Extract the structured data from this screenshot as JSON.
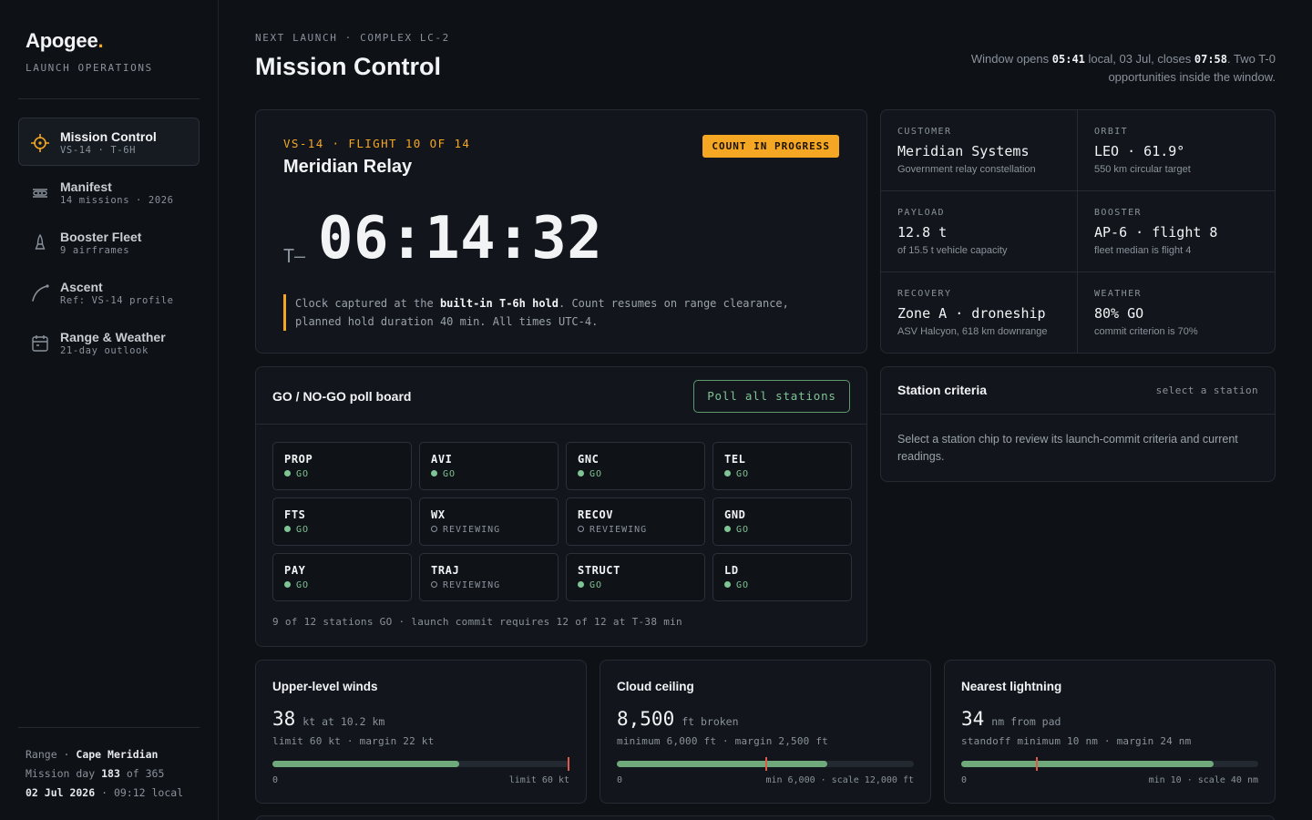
{
  "sidebar": {
    "brand": "Apogee",
    "brand_dot": ".",
    "subtitle": "LAUNCH OPERATIONS",
    "items": [
      {
        "label": "Mission Control",
        "sub": "VS-14 · T-6H",
        "icon": "target-icon"
      },
      {
        "label": "Manifest",
        "sub": "14 missions · 2026",
        "icon": "manifest-icon"
      },
      {
        "label": "Booster Fleet",
        "sub": "9 airframes",
        "icon": "rocket-icon"
      },
      {
        "label": "Ascent",
        "sub": "Ref: VS-14 profile",
        "icon": "trajectory-icon"
      },
      {
        "label": "Range & Weather",
        "sub": "21-day outlook",
        "icon": "calendar-icon"
      }
    ],
    "footer": {
      "range_label": "Range",
      "range_value": "Cape Meridian",
      "mission_day_label": "Mission day",
      "mission_day_value": "183",
      "mission_day_of": "of 365",
      "date": "02 Jul 2026",
      "time": "· 09:12 local"
    }
  },
  "header": {
    "eyebrow": "NEXT LAUNCH · COMPLEX LC-2",
    "title": "Mission Control",
    "window": {
      "prefix": "Window opens",
      "open_time": "05:41",
      "mid": "local, 03 Jul, closes",
      "close_time": "07:58",
      "suffix": ". Two T-0 opportunities inside the window."
    }
  },
  "hero": {
    "flight_tag": "VS-14 · FLIGHT 10 OF 14",
    "mission_name": "Meridian Relay",
    "status": "COUNT IN PROGRESS",
    "t_prefix": "T–",
    "countdown": "06:14:32",
    "note_a": "Clock captured at the",
    "note_bold": "built-in T-6h hold",
    "note_b": ". Count resumes on range clearance, planned hold duration 40 min. All times UTC-4."
  },
  "facts": [
    {
      "label": "CUSTOMER",
      "value": "Meridian Systems",
      "sub": "Government relay constellation"
    },
    {
      "label": "ORBIT",
      "value": "LEO · 61.9°",
      "sub": "550 km circular target"
    },
    {
      "label": "PAYLOAD",
      "value": "12.8 t",
      "sub": "of 15.5 t vehicle capacity"
    },
    {
      "label": "BOOSTER",
      "value": "AP-6 · flight 8",
      "sub": "fleet median is flight 4"
    },
    {
      "label": "RECOVERY",
      "value": "Zone A · droneship",
      "sub": "ASV Halcyon, 618 km downrange"
    },
    {
      "label": "WEATHER",
      "value": "80% GO",
      "sub": "commit criterion is 70%"
    }
  ],
  "poll": {
    "title": "GO / NO-GO poll board",
    "button": "Poll all stations",
    "stations": [
      {
        "name": "PROP",
        "status": "GO"
      },
      {
        "name": "AVI",
        "status": "GO"
      },
      {
        "name": "GNC",
        "status": "GO"
      },
      {
        "name": "TEL",
        "status": "GO"
      },
      {
        "name": "FTS",
        "status": "GO"
      },
      {
        "name": "WX",
        "status": "REVIEWING"
      },
      {
        "name": "RECOV",
        "status": "REVIEWING"
      },
      {
        "name": "GND",
        "status": "GO"
      },
      {
        "name": "PAY",
        "status": "GO"
      },
      {
        "name": "TRAJ",
        "status": "REVIEWING"
      },
      {
        "name": "STRUCT",
        "status": "GO"
      },
      {
        "name": "LD",
        "status": "GO"
      }
    ],
    "footer": "9 of 12 stations GO · launch commit requires 12 of 12 at T-38 min"
  },
  "criteria": {
    "title": "Station criteria",
    "hint": "select a station",
    "body": "Select a station chip to review its launch-commit criteria and current readings."
  },
  "metrics": [
    {
      "title": "Upper-level winds",
      "value": "38",
      "unit": "kt at 10.2 km",
      "limit": "limit 60 kt · margin 22 kt",
      "fill": 0.63,
      "mark": 1.0,
      "scale_left": "0",
      "scale_right": "limit 60 kt"
    },
    {
      "title": "Cloud ceiling",
      "value": "8,500",
      "unit": "ft broken",
      "limit": "minimum 6,000 ft · margin 2,500 ft",
      "fill": 0.708,
      "mark": 0.5,
      "scale_left": "0",
      "scale_right": "min 6,000 · scale 12,000 ft"
    },
    {
      "title": "Nearest lightning",
      "value": "34",
      "unit": "nm from pad",
      "limit": "standoff minimum 10 nm · margin 24 nm",
      "fill": 0.85,
      "mark": 0.25,
      "scale_left": "0",
      "scale_right": "min 10 · scale 40 nm"
    }
  ],
  "colors": {
    "accent": "#f5a623",
    "go": "#7fc495",
    "limit": "#e05a47",
    "bg": "#0e1116"
  }
}
